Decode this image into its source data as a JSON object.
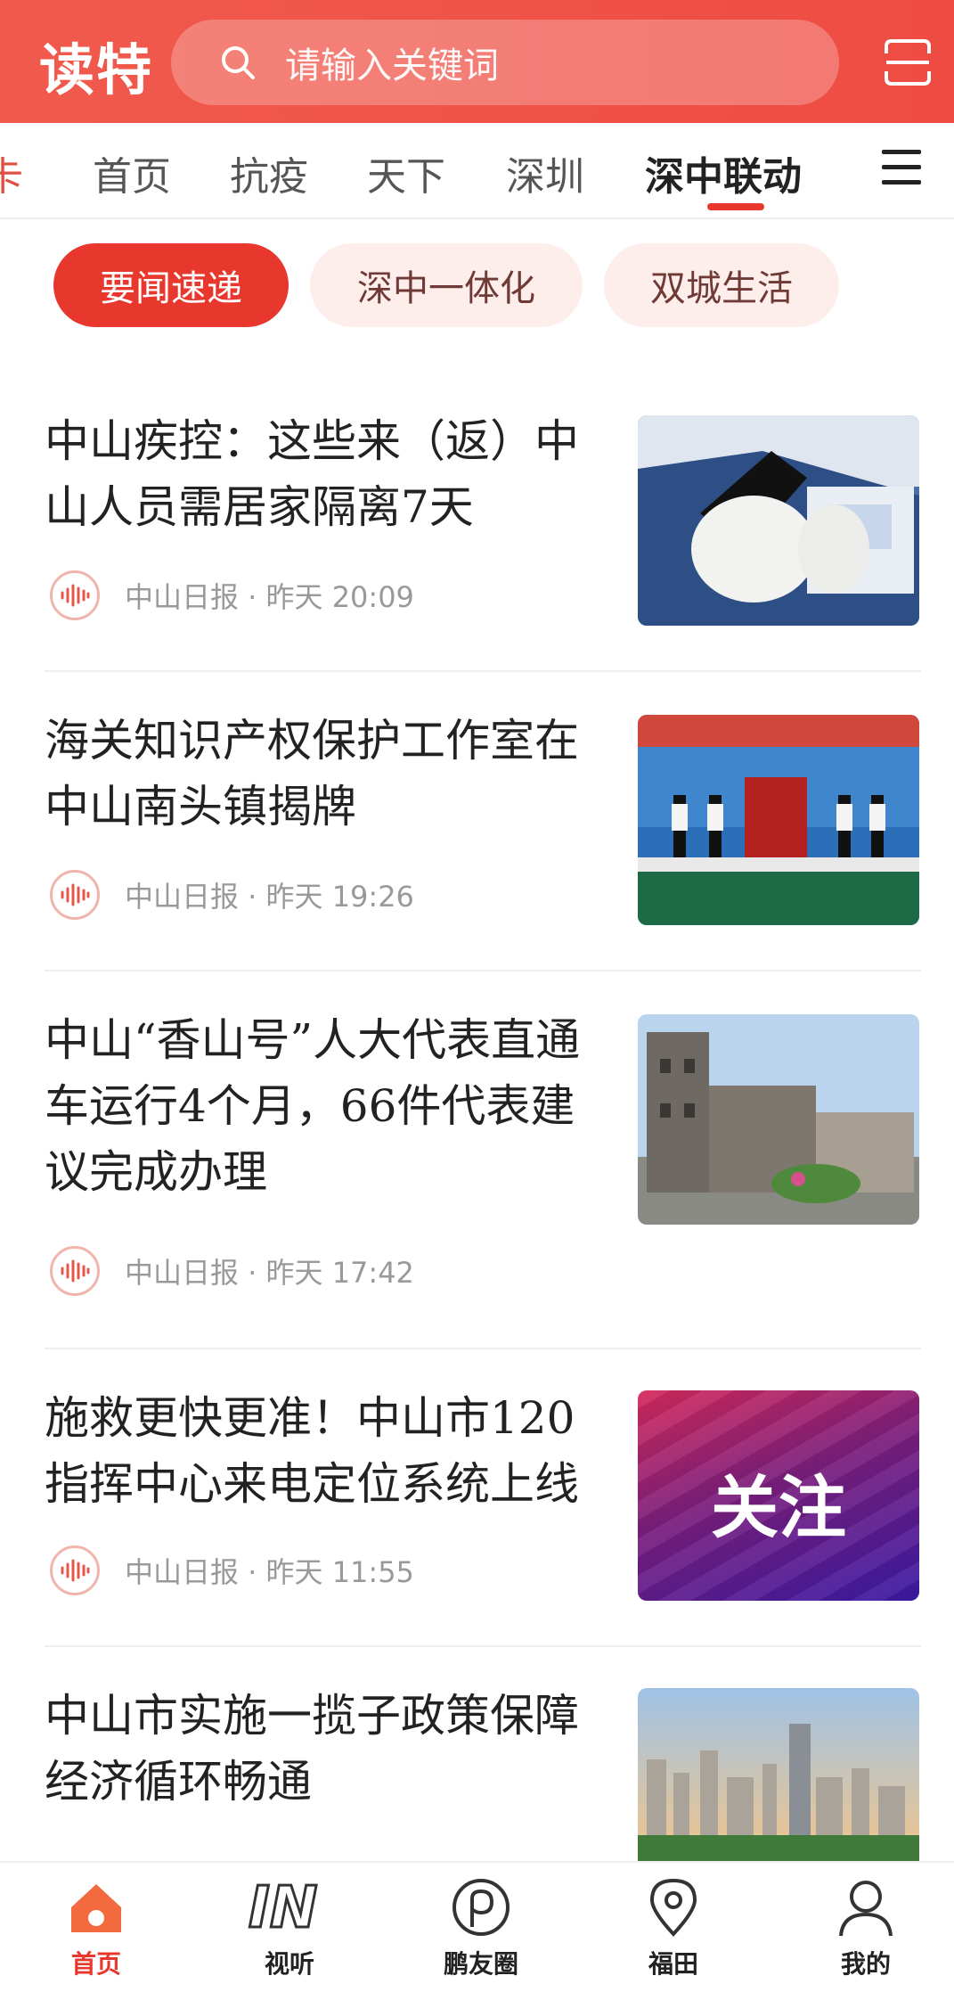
{
  "header": {
    "logo": "读特",
    "search_placeholder": "请输入关键词"
  },
  "tabs": {
    "partial": "卡",
    "items": [
      "首页",
      "抗疫",
      "天下",
      "深圳",
      "深中联动"
    ],
    "active": "深中联动"
  },
  "chips": [
    "要闻速递",
    "深中一体化",
    "双城生活"
  ],
  "articles": [
    {
      "title": "中山疾控：这些来（返）中山人员需居家隔离7天",
      "source": "中山日报 · 昨天  20:09"
    },
    {
      "title": "海关知识产权保护工作室在中山南头镇揭牌",
      "source": "中山日报 · 昨天  19:26"
    },
    {
      "title": "中山“香山号”人大代表直通车运行4个月，66件代表建议完成办理",
      "source": "中山日报 · 昨天  17:42"
    },
    {
      "title": "施救更快更准！中山市120指挥中心来电定位系统上线",
      "source": "中山日报 · 昨天  11:55"
    },
    {
      "title": "中山市实施一揽子政策保障经济循环畅通",
      "source": ""
    }
  ],
  "thumb4_text": "关注",
  "bottom_nav": [
    "首页",
    "视听",
    "鹏友圈",
    "福田",
    "我的"
  ],
  "colors": {
    "accent": "#e8382e",
    "header": "#ef5246"
  }
}
